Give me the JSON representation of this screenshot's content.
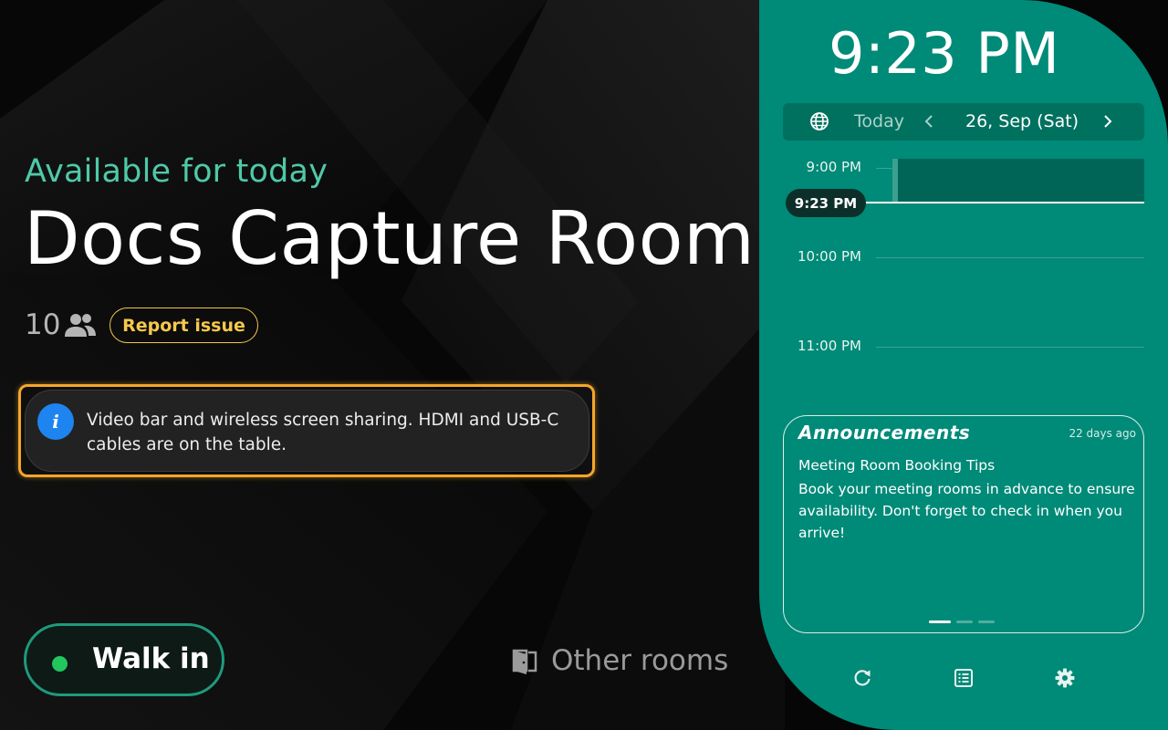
{
  "room": {
    "status": "Available for today",
    "name": "Docs Capture Room",
    "capacity": "10",
    "capacity_icon": "people-icon",
    "report_label": "Report issue"
  },
  "info": {
    "icon": "info-icon",
    "text": "Video bar and wireless screen sharing. HDMI and USB-C cables are on the table."
  },
  "actions": {
    "walk_in_label": "Walk in",
    "other_rooms_label": "Other rooms",
    "other_rooms_icon": "door-icon"
  },
  "clock": {
    "time": "9:23 PM"
  },
  "date_nav": {
    "today_label": "Today",
    "date": "26, Sep (Sat)",
    "globe_icon": "globe-icon",
    "prev_icon": "chevron-left-icon",
    "next_icon": "chevron-right-icon"
  },
  "timeline": {
    "slots": [
      "9:00 PM",
      "10:00 PM",
      "11:00 PM"
    ],
    "current_time": "9:23 PM"
  },
  "announcements": {
    "title": "Announcements",
    "age": "22 days ago",
    "heading": "Meeting Room Booking Tips",
    "body": "Book your meeting rooms in advance to ensure availability. Don't forget to check in when you arrive!",
    "page_count": 3,
    "active_page": 1
  },
  "footer_icons": [
    "refresh-icon",
    "list-icon",
    "settings-icon"
  ],
  "colors": {
    "accent_green": "#4fc9a7",
    "teal_panel": "#008a78",
    "report_yellow": "#f6c84c",
    "highlight_orange": "#f4a62a",
    "info_blue": "#1e84f0",
    "walk_in_dot": "#22c55e"
  }
}
